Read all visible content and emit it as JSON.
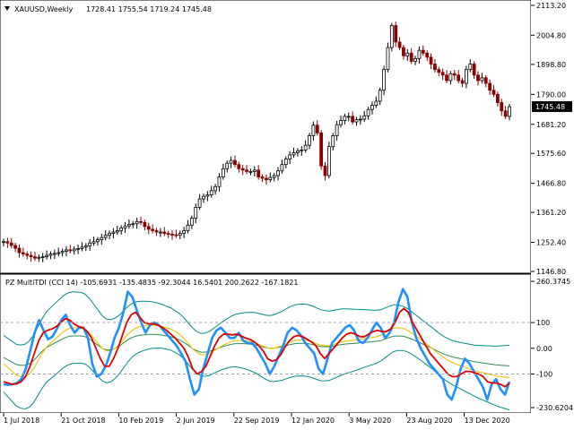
{
  "window": {
    "symbol_header": "XAUUSD,Weekly",
    "ohlc_header": "1728.41 1755.54 1719.24 1745.48",
    "current_price": "1745.48"
  },
  "indicator": {
    "header": "PZ MultiTDI (CCI 14) -105.6931 -135.4835 -92.3044 16.5401 200.2622 -167.1821",
    "max_label": "260.3745",
    "min_label": "-230.6204"
  },
  "colors": {
    "bull_candle": "#000000",
    "bear_candle": "#8b0000",
    "cci_line": "#1e90ff",
    "signal_line": "#e00000",
    "slow_line": "#f2c200",
    "bands": "#008b8b",
    "midline": "#2e8b57"
  },
  "chart_data": [
    {
      "type": "candlestick",
      "title": "XAUUSD,Weekly",
      "y_ticks": [
        "2113.20",
        "2004.80",
        "1898.80",
        "1790.00",
        "1681.20",
        "1575.60",
        "1466.80",
        "1361.20",
        "1252.40",
        "1146.80"
      ],
      "ylim": [
        1146.8,
        2113.2
      ],
      "x_ticks": [
        "1 Jul 2018",
        "21 Oct 2018",
        "10 Feb 2019",
        "2 Jun 2019",
        "22 Sep 2019",
        "12 Jan 2020",
        "3 May 2020",
        "23 Aug 2020",
        "13 Dec 2020"
      ],
      "closes": [
        1255,
        1250,
        1241,
        1231,
        1215,
        1210,
        1205,
        1200,
        1195,
        1198,
        1200,
        1205,
        1210,
        1212,
        1215,
        1220,
        1225,
        1222,
        1228,
        1230,
        1235,
        1240,
        1250,
        1255,
        1262,
        1270,
        1278,
        1285,
        1290,
        1295,
        1305,
        1312,
        1318,
        1320,
        1328,
        1325,
        1310,
        1300,
        1295,
        1290,
        1290,
        1285,
        1282,
        1280,
        1278,
        1285,
        1295,
        1315,
        1340,
        1380,
        1410,
        1420,
        1425,
        1440,
        1455,
        1490,
        1520,
        1540,
        1550,
        1535,
        1520,
        1515,
        1510,
        1510,
        1515,
        1490,
        1485,
        1480,
        1488,
        1495,
        1512,
        1535,
        1555,
        1570,
        1578,
        1585,
        1588,
        1605,
        1640,
        1678,
        1650,
        1530,
        1495,
        1600,
        1640,
        1680,
        1695,
        1710,
        1710,
        1690,
        1698,
        1700,
        1712,
        1735,
        1750,
        1765,
        1805,
        1880,
        1960,
        2040,
        1980,
        1960,
        1930,
        1940,
        1910,
        1920,
        1950,
        1940,
        1925,
        1900,
        1880,
        1870,
        1860,
        1840,
        1865,
        1860,
        1840,
        1830,
        1880,
        1900,
        1860,
        1840,
        1850,
        1830,
        1805,
        1790,
        1760,
        1730,
        1710,
        1745
      ],
      "last": {
        "open": 1728.41,
        "high": 1755.54,
        "low": 1719.24,
        "close": 1745.48
      }
    },
    {
      "type": "line",
      "title": "PZ MultiTDI (CCI 14)",
      "y_ticks": [
        "260.3745",
        "100",
        "0.00",
        "-100",
        "-230.6204"
      ],
      "ylim": [
        -230.6204,
        260.3745
      ],
      "series": [
        {
          "name": "CCI",
          "values": [
            -140,
            -142,
            -140,
            -135,
            -120,
            -80,
            -10,
            60,
            110,
            70,
            35,
            45,
            75,
            110,
            130,
            90,
            60,
            80,
            80,
            40,
            -60,
            -110,
            -100,
            -70,
            -20,
            40,
            80,
            140,
            220,
            200,
            150,
            100,
            60,
            90,
            100,
            90,
            70,
            50,
            30,
            10,
            -20,
            -50,
            -120,
            -180,
            -160,
            -80,
            -20,
            40,
            70,
            80,
            60,
            40,
            40,
            60,
            30,
            20,
            20,
            0,
            -30,
            -60,
            -100,
            -70,
            -30,
            10,
            60,
            80,
            70,
            50,
            20,
            0,
            -20,
            -80,
            -100,
            -40,
            20,
            40,
            60,
            80,
            90,
            70,
            30,
            20,
            40,
            70,
            100,
            80,
            40,
            60,
            100,
            180,
            230,
            200,
            100,
            40,
            0,
            -30,
            -60,
            -80,
            -100,
            -120,
            -180,
            -200,
            -150,
            -80,
            -40,
            -60,
            -90,
            -120,
            -150,
            -200,
            -140,
            -120,
            -160,
            -180,
            -130
          ],
          "color": "#1e90ff"
        },
        {
          "name": "Signal",
          "values": [
            -130,
            -135,
            -140,
            -138,
            -130,
            -110,
            -70,
            -20,
            30,
            60,
            70,
            75,
            85,
            100,
            115,
            110,
            95,
            85,
            80,
            65,
            40,
            0,
            -40,
            -70,
            -70,
            -40,
            0,
            50,
            100,
            130,
            140,
            120,
            100,
            95,
            95,
            90,
            82,
            70,
            55,
            40,
            20,
            0,
            -35,
            -80,
            -100,
            -90,
            -70,
            -30,
            10,
            40,
            55,
            55,
            52,
            55,
            48,
            40,
            35,
            25,
            10,
            -10,
            -40,
            -50,
            -45,
            -25,
            5,
            30,
            45,
            50,
            45,
            35,
            25,
            10,
            -20,
            -40,
            -20,
            0,
            20,
            40,
            55,
            60,
            55,
            45,
            45,
            55,
            65,
            70,
            65,
            65,
            75,
            100,
            140,
            155,
            140,
            100,
            70,
            40,
            10,
            -20,
            -40,
            -60,
            -80,
            -100,
            -110,
            -110,
            -100,
            -90,
            -90,
            -95,
            -100,
            -110,
            -130,
            -135,
            -135,
            -140,
            -150,
            -135
          ],
          "color": "#e00000"
        },
        {
          "name": "Slow",
          "values": [
            -60,
            -75,
            -90,
            -105,
            -110,
            -110,
            -100,
            -80,
            -50,
            -20,
            5,
            20,
            35,
            50,
            65,
            75,
            80,
            80,
            80,
            75,
            60,
            40,
            20,
            0,
            -10,
            -10,
            0,
            15,
            35,
            55,
            70,
            80,
            85,
            88,
            90,
            90,
            88,
            85,
            80,
            75,
            65,
            55,
            40,
            20,
            0,
            -15,
            -25,
            -25,
            -20,
            -10,
            0,
            10,
            18,
            25,
            30,
            30,
            30,
            28,
            25,
            20,
            12,
            5,
            0,
            0,
            5,
            10,
            18,
            25,
            30,
            32,
            32,
            30,
            25,
            18,
            12,
            10,
            10,
            15,
            20,
            25,
            28,
            30,
            32,
            35,
            38,
            40,
            42,
            45,
            50,
            60,
            70,
            78,
            80,
            78,
            72,
            62,
            50,
            38,
            25,
            12,
            0,
            -15,
            -28,
            -40,
            -50,
            -58,
            -64,
            -70,
            -76,
            -82,
            -88,
            -92,
            -96,
            -100,
            -104,
            -108,
            -110,
            -112,
            -114
          ],
          "color": "#f2c200"
        }
      ]
    }
  ]
}
